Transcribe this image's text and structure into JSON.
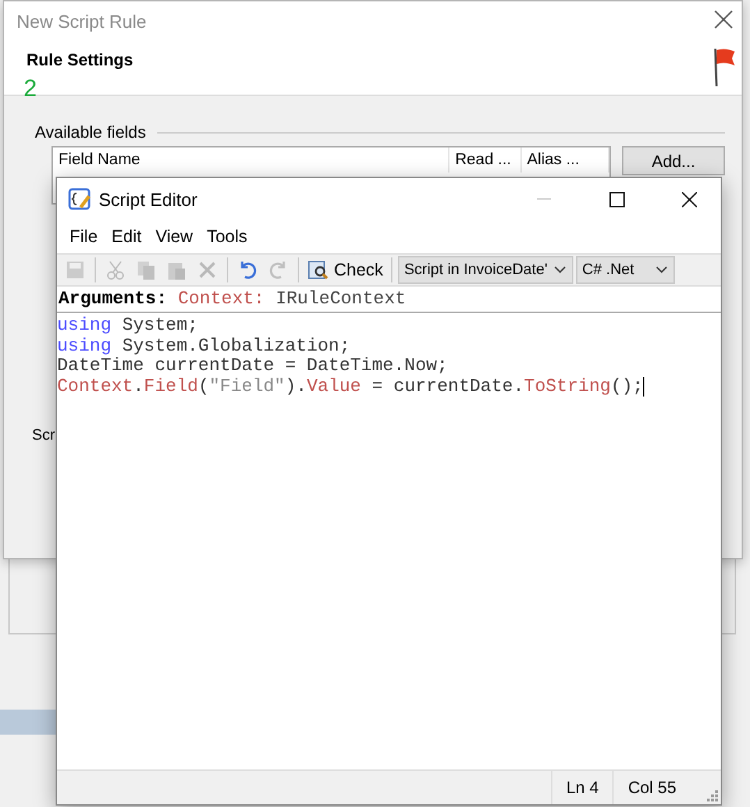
{
  "back_dialog": {
    "title": "New Script Rule",
    "section_title": "Rule Settings",
    "step": "2",
    "group_label": "Available fields",
    "columns": [
      "Field Name",
      "Read ...",
      "Alias ..."
    ],
    "add_button": "Add...",
    "cut_label": "Scr"
  },
  "editor": {
    "title": "Script Editor",
    "menu": [
      "File",
      "Edit",
      "View",
      "Tools"
    ],
    "toolbar": [
      {
        "kind": "save",
        "disabled": true
      },
      {
        "kind": "separator"
      },
      {
        "kind": "cut",
        "disabled": true
      },
      {
        "kind": "copy",
        "disabled": true
      },
      {
        "kind": "paste",
        "disabled": true
      },
      {
        "kind": "delete",
        "disabled": true
      },
      {
        "kind": "separator"
      },
      {
        "kind": "undo",
        "disabled": false
      },
      {
        "kind": "redo",
        "disabled": true
      },
      {
        "kind": "separator"
      },
      {
        "kind": "check",
        "label": "Check"
      },
      {
        "kind": "separator"
      },
      {
        "kind": "select",
        "value": "Script in InvoiceDate'"
      },
      {
        "kind": "select",
        "value": "C# .Net"
      }
    ],
    "arguments": {
      "label": "Arguments:",
      "name": "Context:",
      "type": "IRuleContext"
    },
    "code": [
      [
        {
          "kind": "keyword",
          "text": "using"
        },
        {
          "kind": "plain",
          "text": " System;"
        }
      ],
      [
        {
          "kind": "keyword",
          "text": "using"
        },
        {
          "kind": "plain",
          "text": " System.Globalization;"
        }
      ],
      [
        {
          "kind": "plain",
          "text": "DateTime currentDate = DateTime.Now;"
        }
      ],
      [
        {
          "kind": "member",
          "text": "Context"
        },
        {
          "kind": "plain",
          "text": "."
        },
        {
          "kind": "member",
          "text": "Field"
        },
        {
          "kind": "plain",
          "text": "("
        },
        {
          "kind": "string",
          "text": "\"Field\""
        },
        {
          "kind": "plain",
          "text": ")."
        },
        {
          "kind": "member",
          "text": "Value"
        },
        {
          "kind": "plain",
          "text": " = currentDate."
        },
        {
          "kind": "member",
          "text": "ToString"
        },
        {
          "kind": "plain",
          "text": "();"
        }
      ]
    ],
    "status": {
      "line": "Ln 4",
      "column": "Col 55"
    }
  }
}
